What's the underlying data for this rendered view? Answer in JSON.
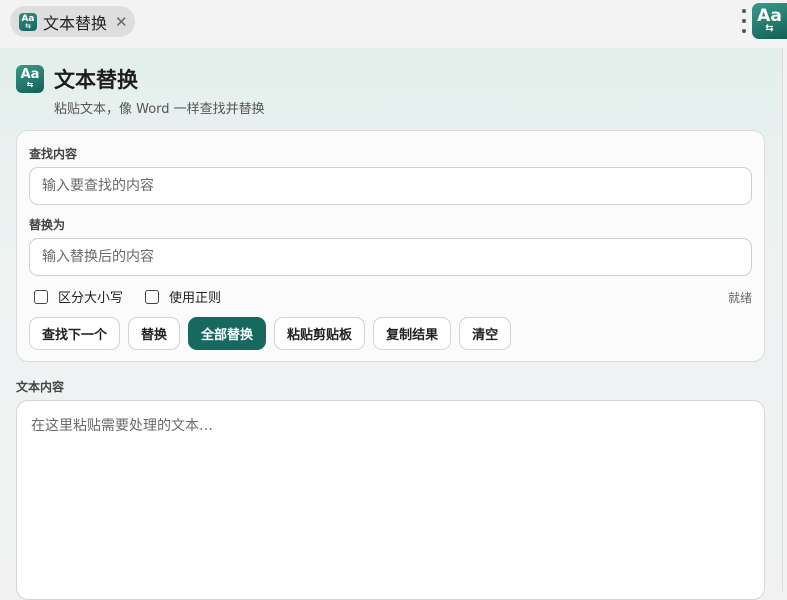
{
  "tab": {
    "icon_text": "Aa",
    "title": "文本替换",
    "close_glyph": "✕"
  },
  "corner_icon": {
    "text": "Aa"
  },
  "header": {
    "icon_text": "Aa",
    "title": "文本替换",
    "subtitle": "粘贴文本，像 Word 一样查找并替换"
  },
  "find": {
    "label": "查找内容",
    "placeholder": "输入要查找的内容",
    "value": ""
  },
  "replace": {
    "label": "替换为",
    "placeholder": "输入替换后的内容",
    "value": ""
  },
  "options": {
    "case_label": "区分大小写",
    "case_checked": false,
    "regex_label": "使用正则",
    "regex_checked": false
  },
  "status": "就绪",
  "buttons": {
    "find_next": "查找下一个",
    "replace": "替换",
    "replace_all": "全部替换",
    "paste": "粘贴剪贴板",
    "copy": "复制结果",
    "clear": "清空"
  },
  "content": {
    "label": "文本内容",
    "placeholder": "在这里粘贴需要处理的文本…",
    "value": ""
  },
  "colors": {
    "accent": "#17695f",
    "icon_gradient_start": "#3a9a89",
    "icon_gradient_end": "#135f56"
  },
  "icons": {
    "app_icon": "text-replace-icon",
    "close": "close-icon",
    "more": "kebab-menu-icon",
    "checkbox": "checkbox-unchecked-icon"
  }
}
